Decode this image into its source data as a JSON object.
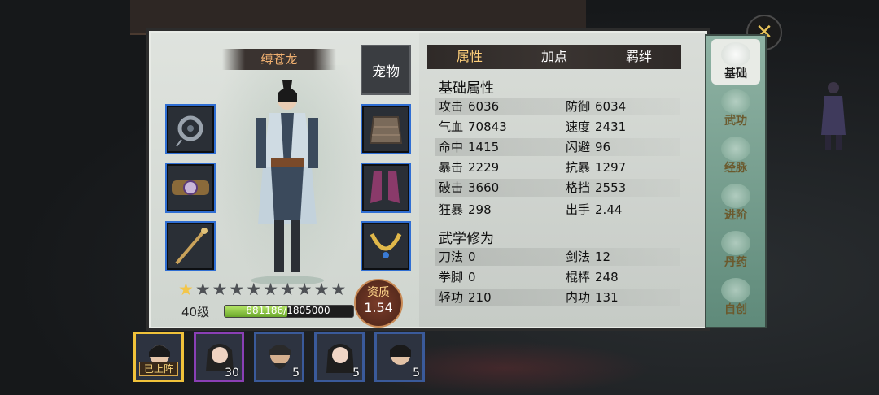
{
  "character": {
    "name": "缚苍龙",
    "pet_button": "宠物",
    "level": "40级",
    "exp_text": "881186/1805000",
    "exp_fraction": 0.488,
    "stars_total": 10,
    "stars_filled": 1,
    "aptitude_label": "资质",
    "aptitude_value": "1.54"
  },
  "tabs": [
    {
      "label": "属性",
      "active": true
    },
    {
      "label": "加点",
      "active": false
    },
    {
      "label": "羁绊",
      "active": false
    }
  ],
  "basic_title": "基础属性",
  "basic_stats": [
    {
      "label": "攻击",
      "value": "6036"
    },
    {
      "label": "防御",
      "value": "6034"
    },
    {
      "label": "气血",
      "value": "70843"
    },
    {
      "label": "速度",
      "value": "2431"
    },
    {
      "label": "命中",
      "value": "1415"
    },
    {
      "label": "闪避",
      "value": "96"
    },
    {
      "label": "暴击",
      "value": "2229"
    },
    {
      "label": "抗暴",
      "value": "1297"
    },
    {
      "label": "破击",
      "value": "3660"
    },
    {
      "label": "格挡",
      "value": "2553"
    },
    {
      "label": "狂暴",
      "value": "298"
    },
    {
      "label": "出手",
      "value": "2.44"
    }
  ],
  "martial_title": "武学修为",
  "martial_stats": [
    {
      "label": "刀法",
      "value": "0"
    },
    {
      "label": "剑法",
      "value": "12"
    },
    {
      "label": "拳脚",
      "value": "0"
    },
    {
      "label": "棍棒",
      "value": "248"
    },
    {
      "label": "轻功",
      "value": "210"
    },
    {
      "label": "内功",
      "value": "131"
    }
  ],
  "side_tabs": [
    {
      "label": "基础",
      "icon": "portrait-icon",
      "active": true
    },
    {
      "label": "武功",
      "icon": "kungfu-icon",
      "active": false
    },
    {
      "label": "经脉",
      "icon": "meridian-icon",
      "active": false
    },
    {
      "label": "进阶",
      "icon": "flame-icon",
      "active": false
    },
    {
      "label": "丹药",
      "icon": "gourd-icon",
      "active": false
    },
    {
      "label": "自创",
      "icon": "book-icon",
      "active": false
    }
  ],
  "roster": [
    {
      "count": "",
      "tag": "已上阵",
      "frame": "gold"
    },
    {
      "count": "30",
      "tag": "",
      "frame": "purple"
    },
    {
      "count": "5",
      "tag": "",
      "frame": "blue"
    },
    {
      "count": "5",
      "tag": "",
      "frame": "blue"
    },
    {
      "count": "5",
      "tag": "",
      "frame": "blue"
    }
  ],
  "close_label": "✕",
  "equipment_slots": [
    "jade-pendant-icon",
    "belt-icon",
    "staff-icon",
    "armor-icon",
    "boots-icon",
    "necklace-icon"
  ]
}
